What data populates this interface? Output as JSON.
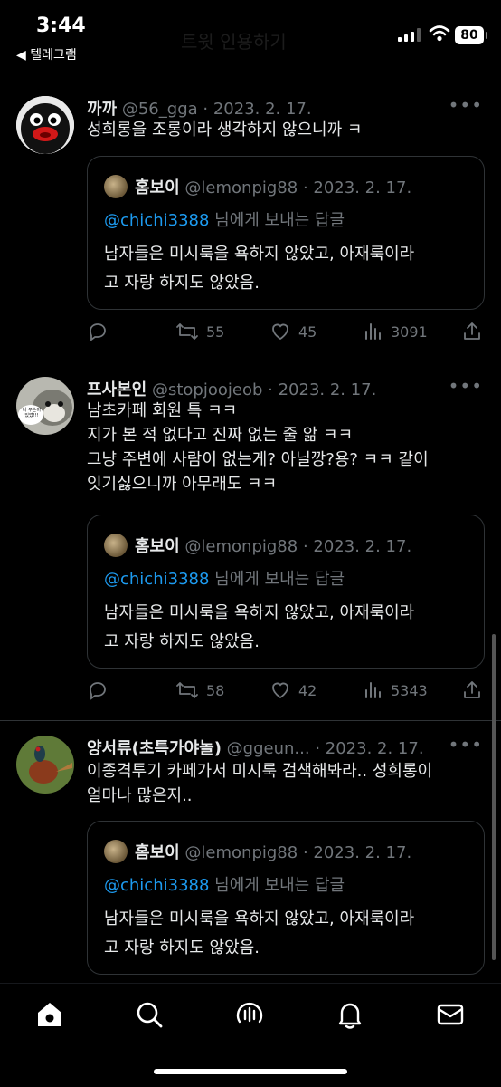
{
  "status_bar": {
    "time": "3:44",
    "back_label": "◀ 텔레그램",
    "battery": "80"
  },
  "header": {
    "ghost_title": "트윗 인용하기"
  },
  "tweets": [
    {
      "name": "까까",
      "handle": "@56_gga",
      "date": "· 2023. 2. 17.",
      "text": "성희롱을 조롱이라 생각하지 않으니까 ㅋ",
      "quote": {
        "name": "홈보이",
        "handle": "@lemonpig88",
        "date": "· 2023. 2. 17.",
        "mention": "@chichi3388",
        "reply_suffix": " 님에게 보내는 답글",
        "line1": "남자들은 미시룩을 욕하지 않았고, 아재룩이라",
        "line2": "고 자랑 하지도 않았음."
      },
      "retweets": "55",
      "likes": "45",
      "views": "3091"
    },
    {
      "name": "프사본인",
      "handle": "@stopjoojeob",
      "date": "· 2023. 2. 17.",
      "text_lines": [
        "남초카페 회원 특 ㅋㅋ",
        "지가 본 적 없다고 진짜 없는 줄 앎 ㅋㅋ",
        "그냥 주변에 사람이 없는게? 아닐깡?용? ㅋㅋ 같이",
        "잇기싫으니까 아무래도 ㅋㅋ"
      ],
      "quote": {
        "name": "홈보이",
        "handle": "@lemonpig88",
        "date": "· 2023. 2. 17.",
        "mention": "@chichi3388",
        "reply_suffix": " 님에게 보내는 답글",
        "line1": "남자들은 미시룩을 욕하지 않았고, 아재룩이라",
        "line2": "고 자랑 하지도 않았음."
      },
      "retweets": "58",
      "likes": "42",
      "views": "5343"
    },
    {
      "name": "양서류(초특가야놀)",
      "handle": "@ggeun...",
      "date": "· 2023. 2. 17.",
      "text_lines": [
        "이종격투기 카페가서 미시룩 검색해봐라.. 성희롱이",
        "얼마나 많은지.."
      ],
      "quote": {
        "name": "홈보이",
        "handle": "@lemonpig88",
        "date": "· 2023. 2. 17.",
        "mention": "@chichi3388",
        "reply_suffix": " 님에게 보내는 답글",
        "line1": "남자들은 미시룩을 욕하지 않았고, 아재룩이라",
        "line2": "고 자랑 하지도 않았음."
      }
    }
  ],
  "avatar2_text": "나 무슨이 있었!!!",
  "more_label": "•••",
  "colors": {
    "background": "#000000",
    "text": "#e7e9ea",
    "secondary": "#71767b",
    "link": "#1d9bf0",
    "divider": "#2f3336"
  },
  "icons": [
    "home-icon",
    "search-icon",
    "spaces-icon",
    "bell-icon",
    "mail-icon"
  ]
}
